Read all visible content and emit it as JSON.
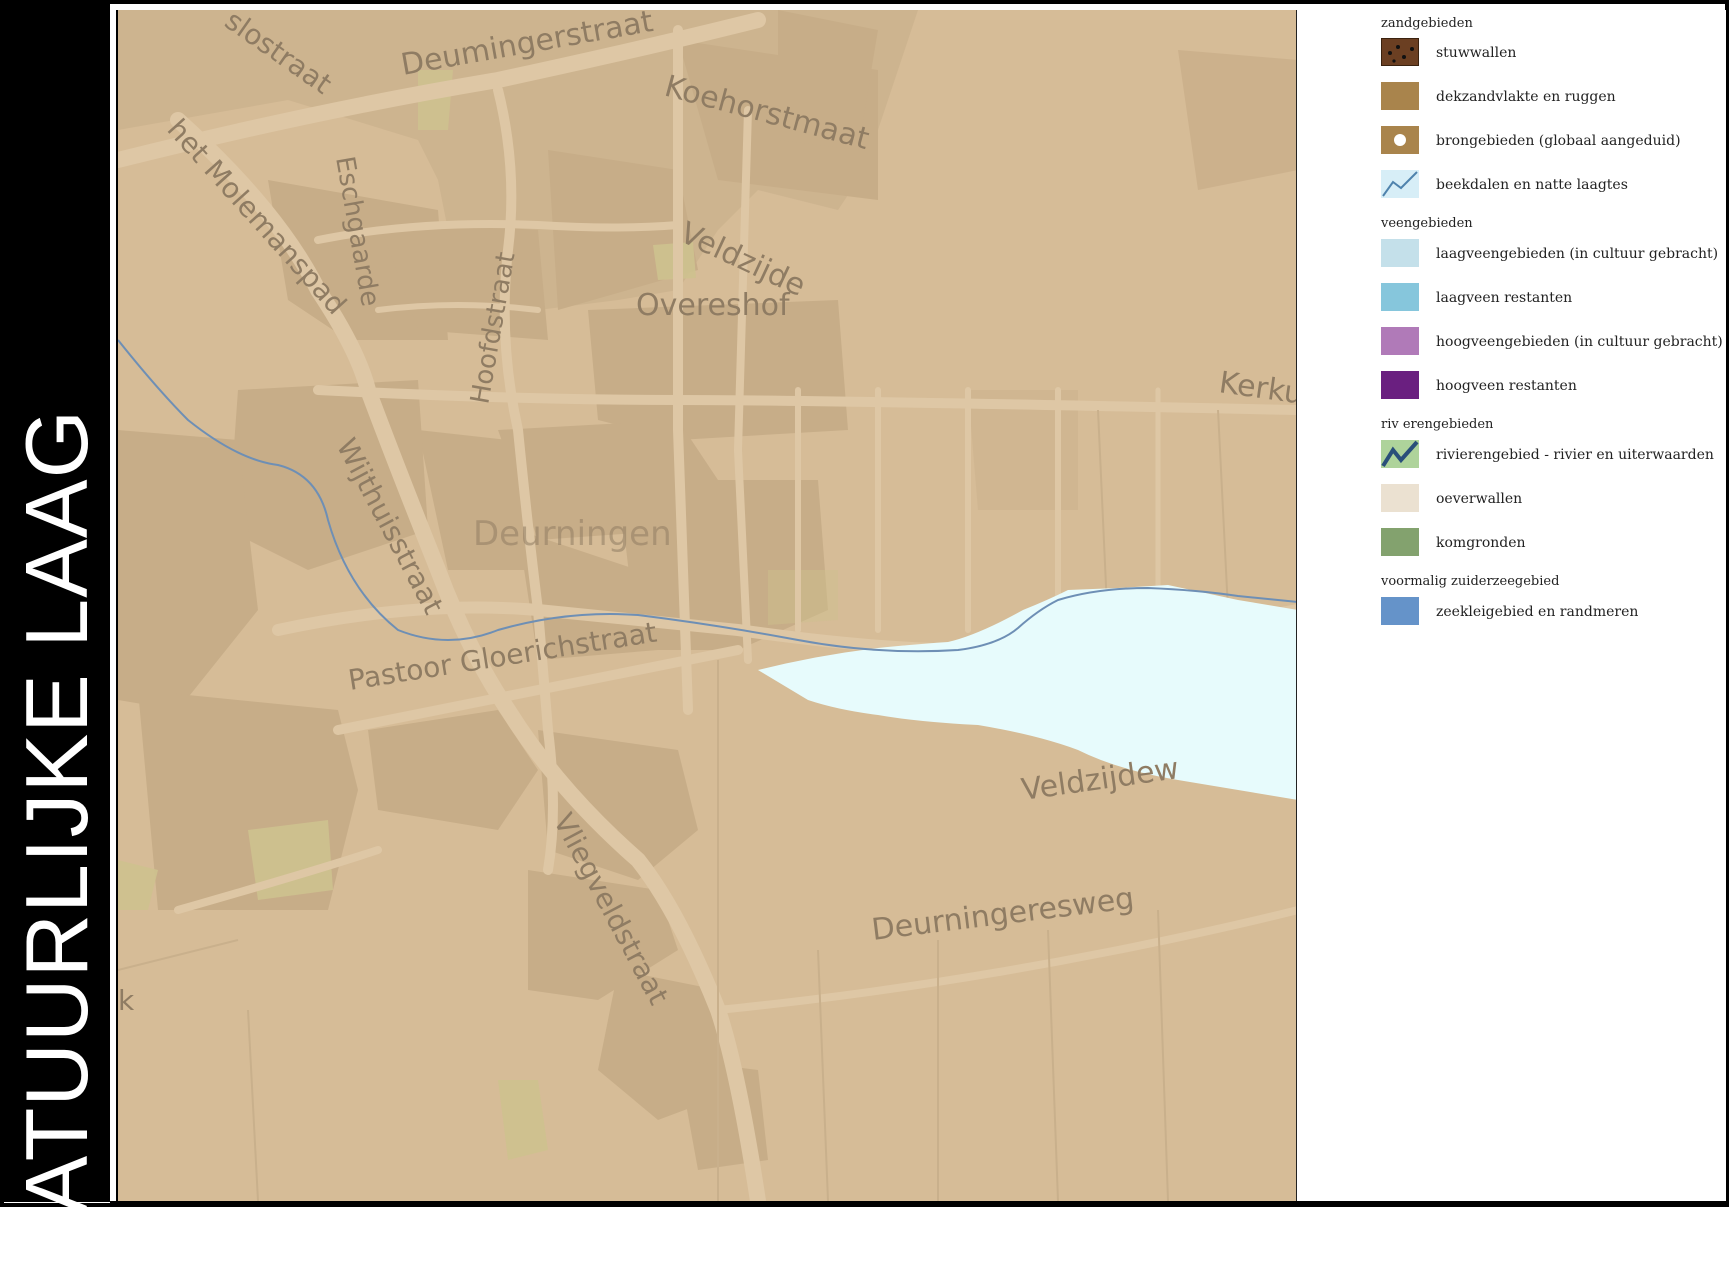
{
  "title": "NATUURLIJKE LAAG",
  "map": {
    "street_labels": {
      "deumingerstraat": "Deumingerstraat",
      "slostraat": "slostraat",
      "koehorstmaat": "Koehorstmaat",
      "het_molemanspad": "het Molemanspad",
      "eschgaarde": "Eschgaarde",
      "hoofdstraat": "Hoofdstraat",
      "veldzijde": "Veldzijde",
      "overeshof": "Overeshof",
      "kerk": "Kerku",
      "wijthuisstraat": "Wijthuisstraat",
      "deurningen": "Deurningen",
      "pastoor": "Pastoor Gloerichstraat",
      "veldzijdew": "Veldzijdew",
      "vliegveldstraat": "Vliegveldstraat",
      "deurningeresweg": "Deurningeresweg",
      "k": "k"
    },
    "colors": {
      "base": "#d6bc97",
      "built": "#c7ad88",
      "road": "#dec7a5",
      "wet": "#e7fbfc",
      "stream": "#6e8fb5",
      "label": "#8f7c63"
    }
  },
  "legend": {
    "groups": [
      {
        "title": "zandgebieden",
        "items": [
          {
            "label": "stuwwallen",
            "color": "#6b3f22",
            "icon": "stuwwal-dots-icon"
          },
          {
            "label": "dekzandvlakte en ruggen",
            "color": "#a9844c",
            "icon": "solid-swatch-icon"
          },
          {
            "label": "brongebieden (globaal aangeduid)",
            "color": "#a9844c",
            "icon": "spring-dot-icon"
          },
          {
            "label": "beekdalen en natte laagtes",
            "color": "#d7eef7",
            "icon": "stream-line-icon"
          }
        ]
      },
      {
        "title": "veengebieden",
        "items": [
          {
            "label": "laagveengebieden (in cultuur gebracht)",
            "color": "#c4e0ea",
            "icon": "solid-swatch-icon"
          },
          {
            "label": "laagveen restanten",
            "color": "#86c6dc",
            "icon": "solid-swatch-icon"
          },
          {
            "label": "hoogveengebieden (in cultuur gebracht)",
            "color": "#b07ab8",
            "icon": "solid-swatch-icon"
          },
          {
            "label": "hoogveen restanten",
            "color": "#6a1f80",
            "icon": "solid-swatch-icon"
          }
        ]
      },
      {
        "title": "riv erengebieden",
        "items": [
          {
            "label": "rivierengebied - rivier en uiterwaarden",
            "color": "#aed39b",
            "icon": "river-line-icon"
          },
          {
            "label": "oeverwallen",
            "color": "#ebe1d1",
            "icon": "solid-swatch-icon"
          },
          {
            "label": "komgronden",
            "color": "#83a26e",
            "icon": "solid-swatch-icon"
          }
        ]
      },
      {
        "title": "voormalig zuiderzeegebied",
        "items": [
          {
            "label": "zeekleigebied en randmeren",
            "color": "#6593c9",
            "icon": "solid-swatch-icon"
          }
        ]
      }
    ]
  }
}
